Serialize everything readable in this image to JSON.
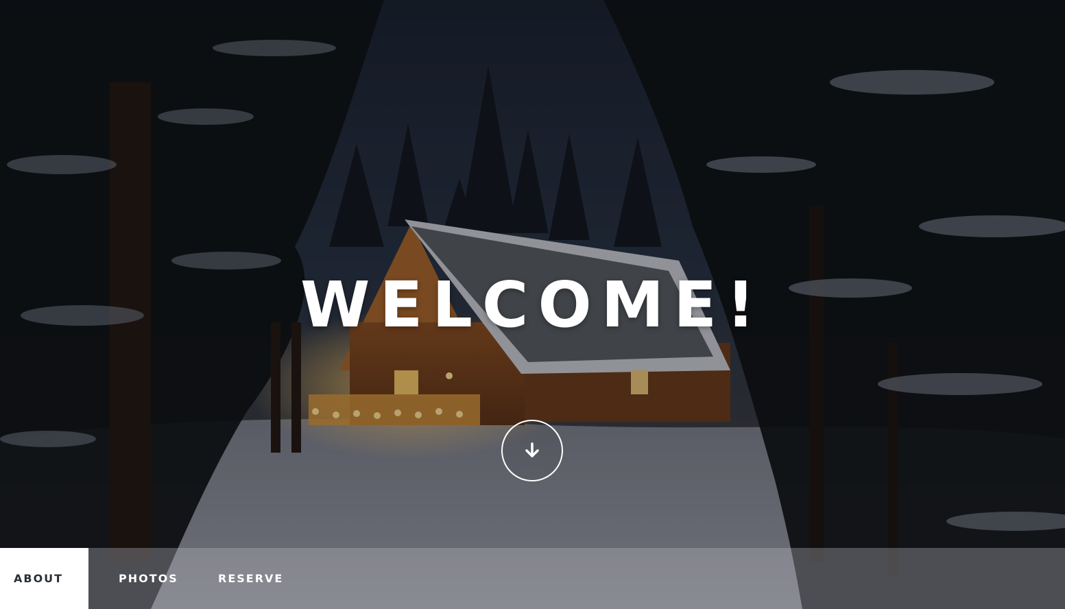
{
  "hero": {
    "headline": "WELCOME!",
    "scroll_icon": "arrow-down-icon"
  },
  "nav": {
    "items": [
      {
        "label": "ABOUT",
        "active": true
      },
      {
        "label": "PHOTOS",
        "active": false
      },
      {
        "label": "RESERVE",
        "active": false
      }
    ]
  },
  "colors": {
    "sky": "#1f2a3c",
    "cabin_glow": "#e8a24a",
    "nav_active_bg": "#ffffff",
    "nav_active_text": "#2b2f36",
    "nav_text": "#ffffff"
  }
}
